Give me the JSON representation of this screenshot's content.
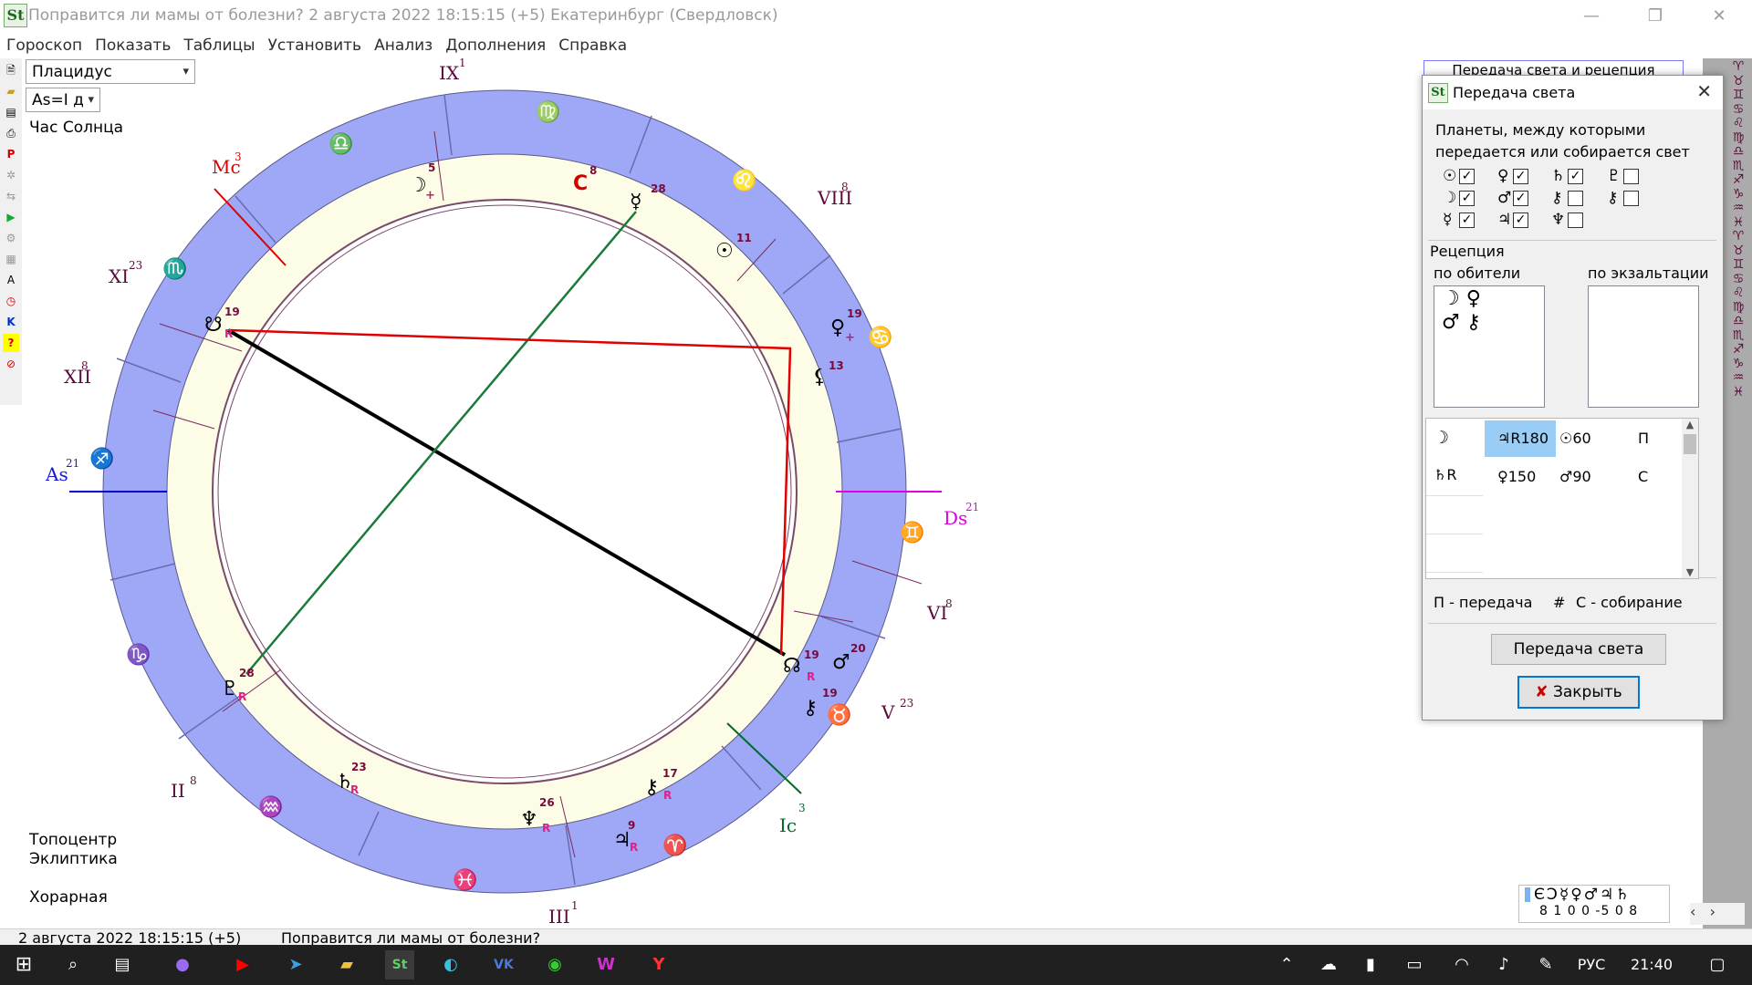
{
  "window": {
    "title": "Поправится ли мамы от болезни?  2 августа 2022 18:15:15 (+5)  Екатеринбург (Свердловск)"
  },
  "menu": [
    "Гороскоп",
    "Показать",
    "Таблицы",
    "Установить",
    "Анализ",
    "Дополнения",
    "Справка"
  ],
  "left_panel": {
    "house_system": "Плацидус",
    "asc_mode": "As=I д",
    "planet_hour": "Час Солнца",
    "topocenter": "Топоцентр",
    "ecliptic": "Эклиптика",
    "chart_type": "Хорарная"
  },
  "chart": {
    "houses": [
      {
        "label": "IX",
        "deg": "1"
      },
      {
        "label": "Mc",
        "deg": "3"
      },
      {
        "label": "XI",
        "deg": "23"
      },
      {
        "label": "XII",
        "deg": "8"
      },
      {
        "label": "As",
        "deg": "21"
      },
      {
        "label": "II",
        "deg": "8"
      },
      {
        "label": "III",
        "deg": "1"
      },
      {
        "label": "Ic",
        "deg": "3"
      },
      {
        "label": "V",
        "deg": "23"
      },
      {
        "label": "VI",
        "deg": "8"
      },
      {
        "label": "Ds",
        "deg": "21"
      },
      {
        "label": "VIII",
        "deg": "8"
      }
    ],
    "signs": [
      "♍",
      "♎",
      "♏",
      "♐",
      "♑",
      "♒",
      "♓",
      "♈",
      "♉",
      "♊",
      "♋",
      "♌"
    ],
    "planets": [
      {
        "glyph": "☽",
        "deg": "5"
      },
      {
        "glyph": "С",
        "deg": "8"
      },
      {
        "glyph": "☿",
        "deg": "28"
      },
      {
        "glyph": "☉",
        "deg": "11"
      },
      {
        "glyph": "♀",
        "deg": "19"
      },
      {
        "glyph": "⚸",
        "deg": "13"
      },
      {
        "glyph": "☋",
        "deg": "19"
      },
      {
        "glyph": "♇",
        "deg": "28"
      },
      {
        "glyph": "☊",
        "deg": "19"
      },
      {
        "glyph": "♂",
        "deg": "20"
      },
      {
        "glyph": "⚷",
        "deg": "19"
      },
      {
        "glyph": "♄",
        "deg": "23"
      },
      {
        "glyph": "♆",
        "deg": "26"
      },
      {
        "glyph": "♃",
        "deg": "9"
      },
      {
        "glyph": "⚷",
        "deg": "17"
      }
    ]
  },
  "dialog": {
    "tab_behind": "Передача света и рецепция",
    "title": "Передача света",
    "desc1": "Планеты, между которыми",
    "desc2": "передается или собирается свет",
    "checkboxes": [
      {
        "glyph": "☉",
        "checked": true
      },
      {
        "glyph": "♀",
        "checked": true
      },
      {
        "glyph": "♄",
        "checked": true
      },
      {
        "glyph": "♇",
        "checked": false
      },
      {
        "glyph": "☽",
        "checked": true
      },
      {
        "glyph": "♂",
        "checked": true
      },
      {
        "glyph": "⚷",
        "checked": false
      },
      {
        "glyph": "⚷",
        "checked": false
      },
      {
        "glyph": "☿",
        "checked": true
      },
      {
        "glyph": "♃",
        "checked": true
      },
      {
        "glyph": "♆",
        "checked": false
      }
    ],
    "reception": "Рецепция",
    "domicile": "по обители",
    "exaltation": "по экзальтации",
    "domicile_items": [
      "☽ ♀",
      "♂ ⚷"
    ],
    "grid_rows": [
      [
        "☽",
        "♃R180",
        "☉60",
        "П"
      ],
      [
        "♄R",
        "♀150",
        "♂90",
        "С"
      ]
    ],
    "legend_p": "П - передача",
    "legend_hash": "#",
    "legend_c": "С - собирание",
    "btn_transfer": "Передача света",
    "btn_close": "Закрыть"
  },
  "mini_table": {
    "glyphs": "ЄϽ☿♀♂♃♄",
    "values": "8 1 0 0 -5 0 8"
  },
  "status": {
    "date": "2 августа 2022   18:15:15 (+5)",
    "question": "Поправится ли мамы от болезни?"
  },
  "taskbar": {
    "lang": "РУС",
    "time": "21:40"
  }
}
